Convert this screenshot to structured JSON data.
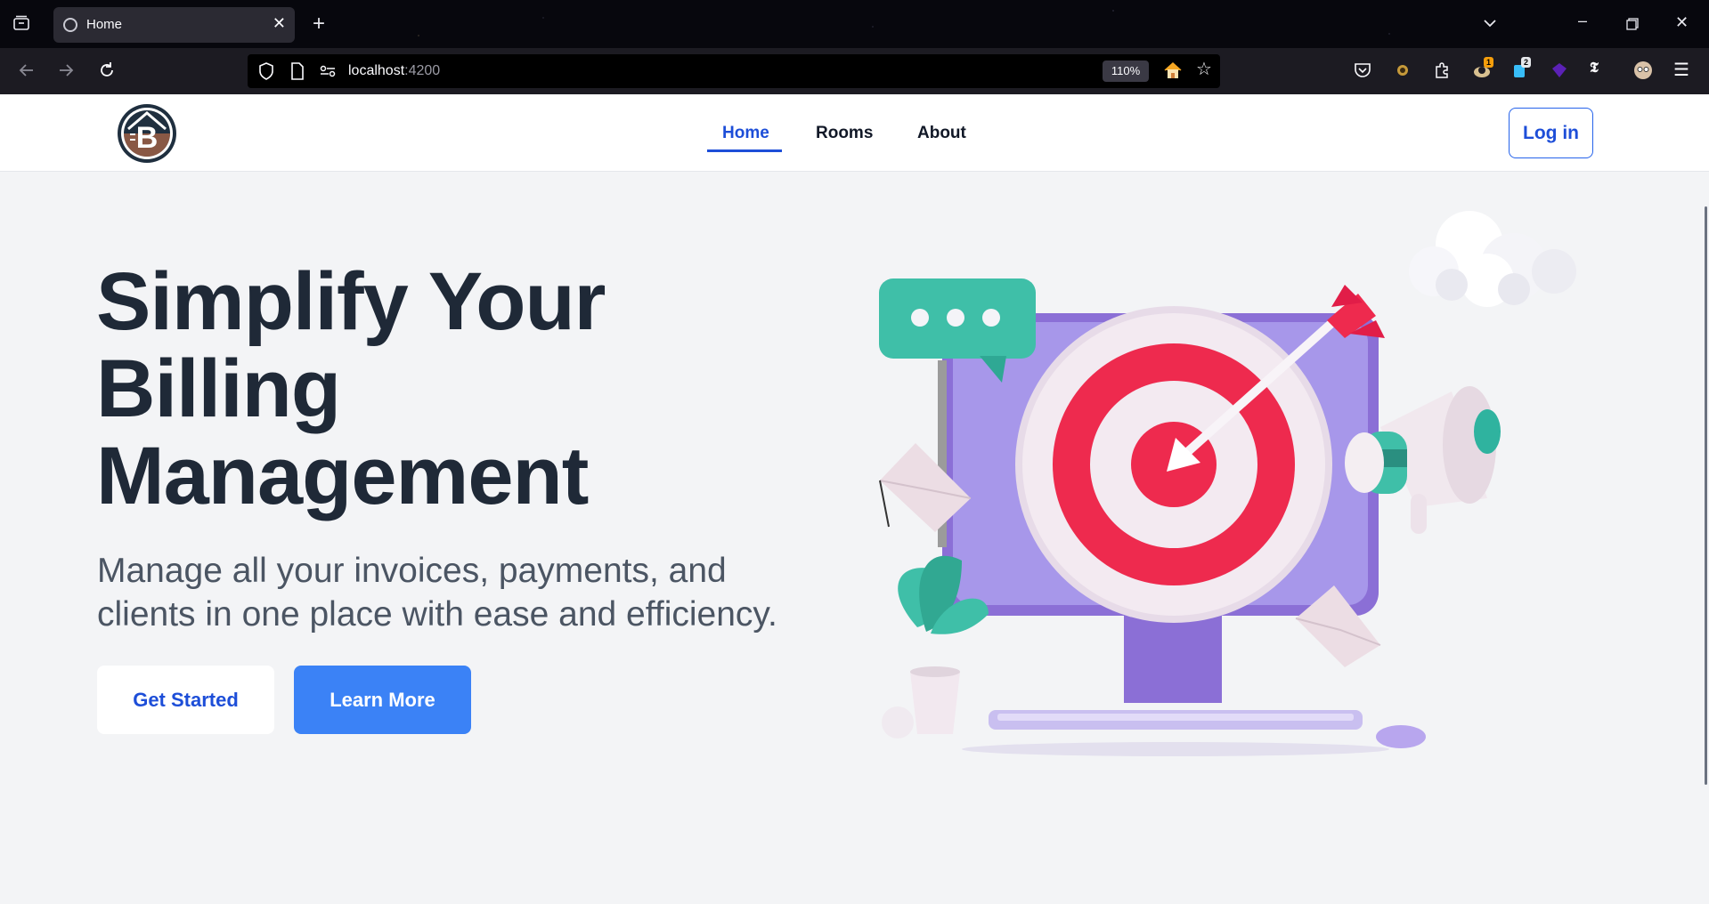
{
  "browser": {
    "tab_title": "Home",
    "url_host": "localhost",
    "url_port": ":4200",
    "zoom": "110%",
    "extension_badges": [
      "1",
      "2"
    ]
  },
  "header": {
    "nav": [
      "Home",
      "Rooms",
      "About"
    ],
    "active_nav": "Home",
    "login_label": "Log in"
  },
  "hero": {
    "title_line1": "Simplify Your",
    "title_line2": "Billing",
    "title_line3": "Management",
    "subtitle_line1": "Manage all your invoices, payments, and",
    "subtitle_line2": "clients in one place with ease and efficiency.",
    "primary_button": "Get Started",
    "secondary_button": "Learn More"
  },
  "colors": {
    "accent": "#3b82f6",
    "accent_dark": "#1d4ed8",
    "background": "#f3f4f6",
    "heading": "#1f2937",
    "target_red": "#f0264d",
    "monitor_purple": "#9b8ae6",
    "teal": "#3fbfa8"
  }
}
